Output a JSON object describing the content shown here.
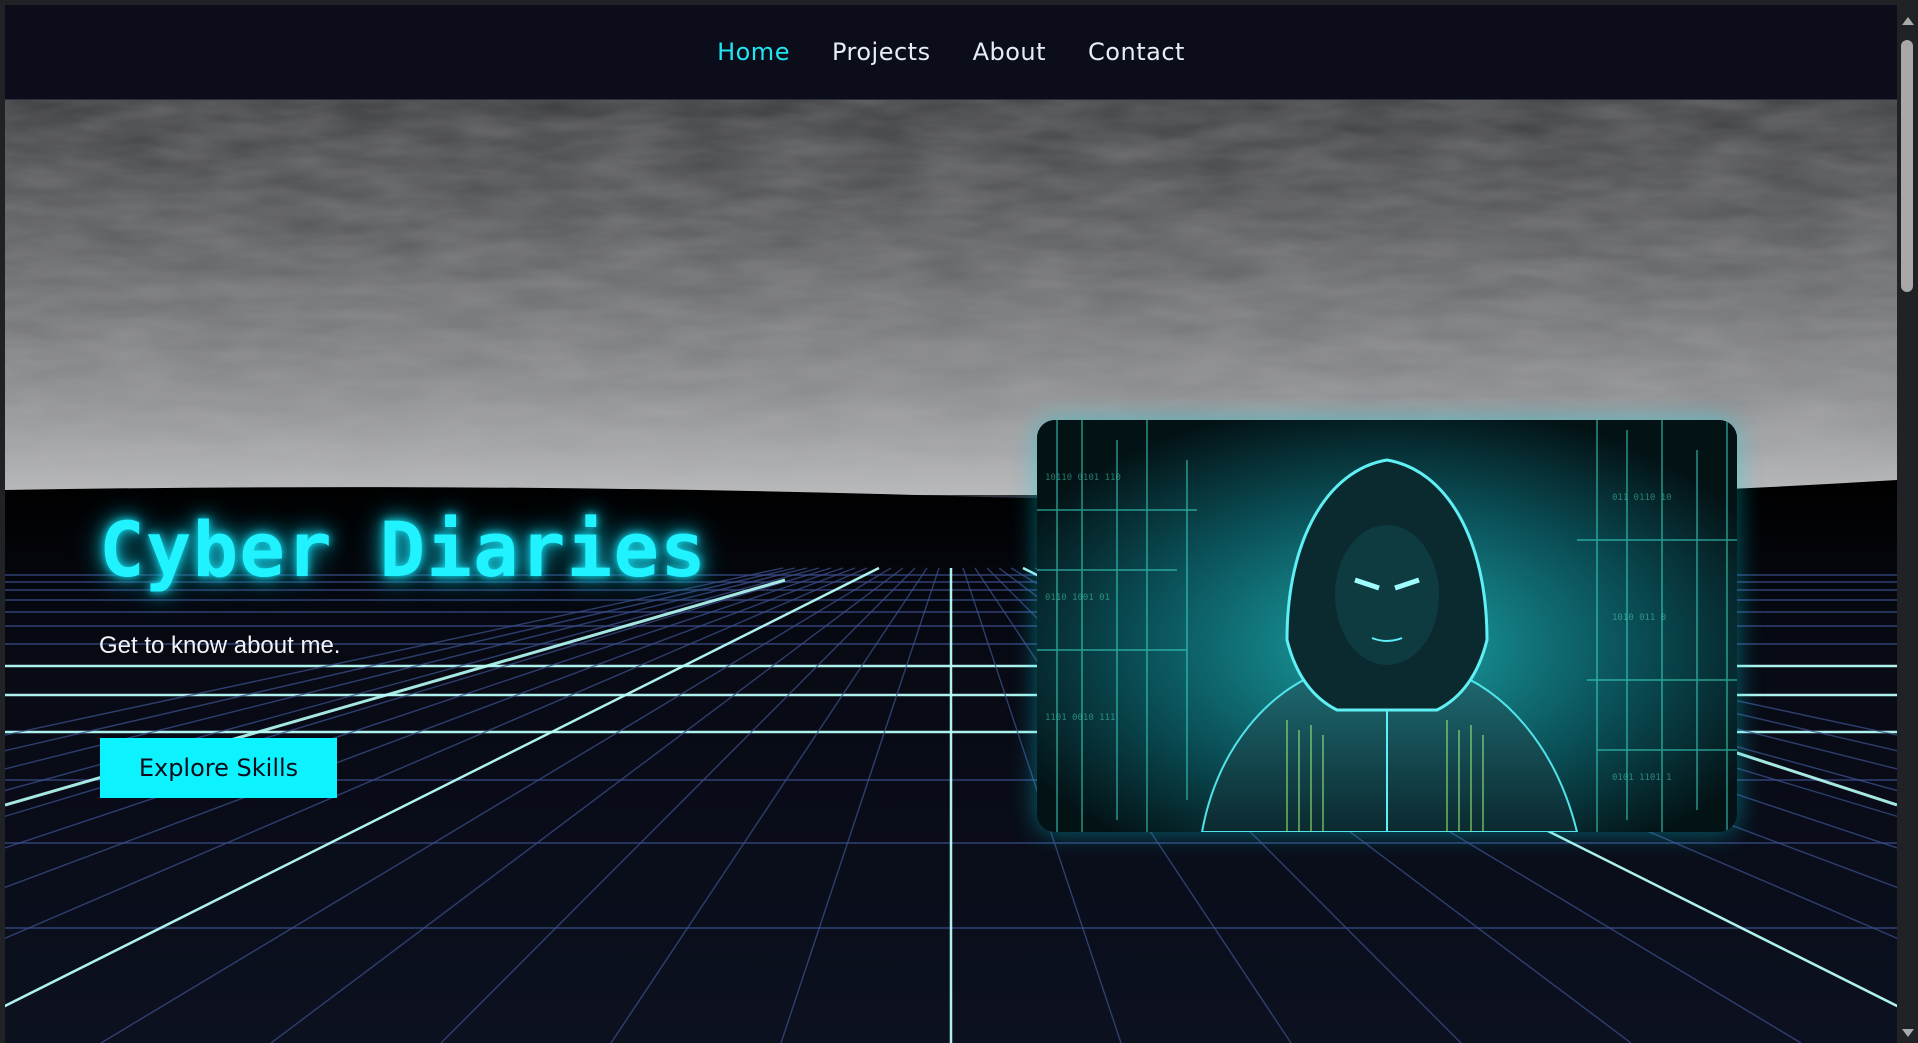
{
  "nav": {
    "items": [
      {
        "label": "Home",
        "active": true
      },
      {
        "label": "Projects",
        "active": false
      },
      {
        "label": "About",
        "active": false
      },
      {
        "label": "Contact",
        "active": false
      }
    ]
  },
  "hero": {
    "title": "Cyber Diaries",
    "subtitle": "Get to know about me.",
    "cta_label": "Explore Skills"
  },
  "colors": {
    "accent": "#1fe6f2",
    "background": "#0b0e1a",
    "grid": "#b8fff9"
  },
  "icons": {
    "scroll_up": "chevron-up-icon",
    "scroll_down": "chevron-down-icon"
  }
}
